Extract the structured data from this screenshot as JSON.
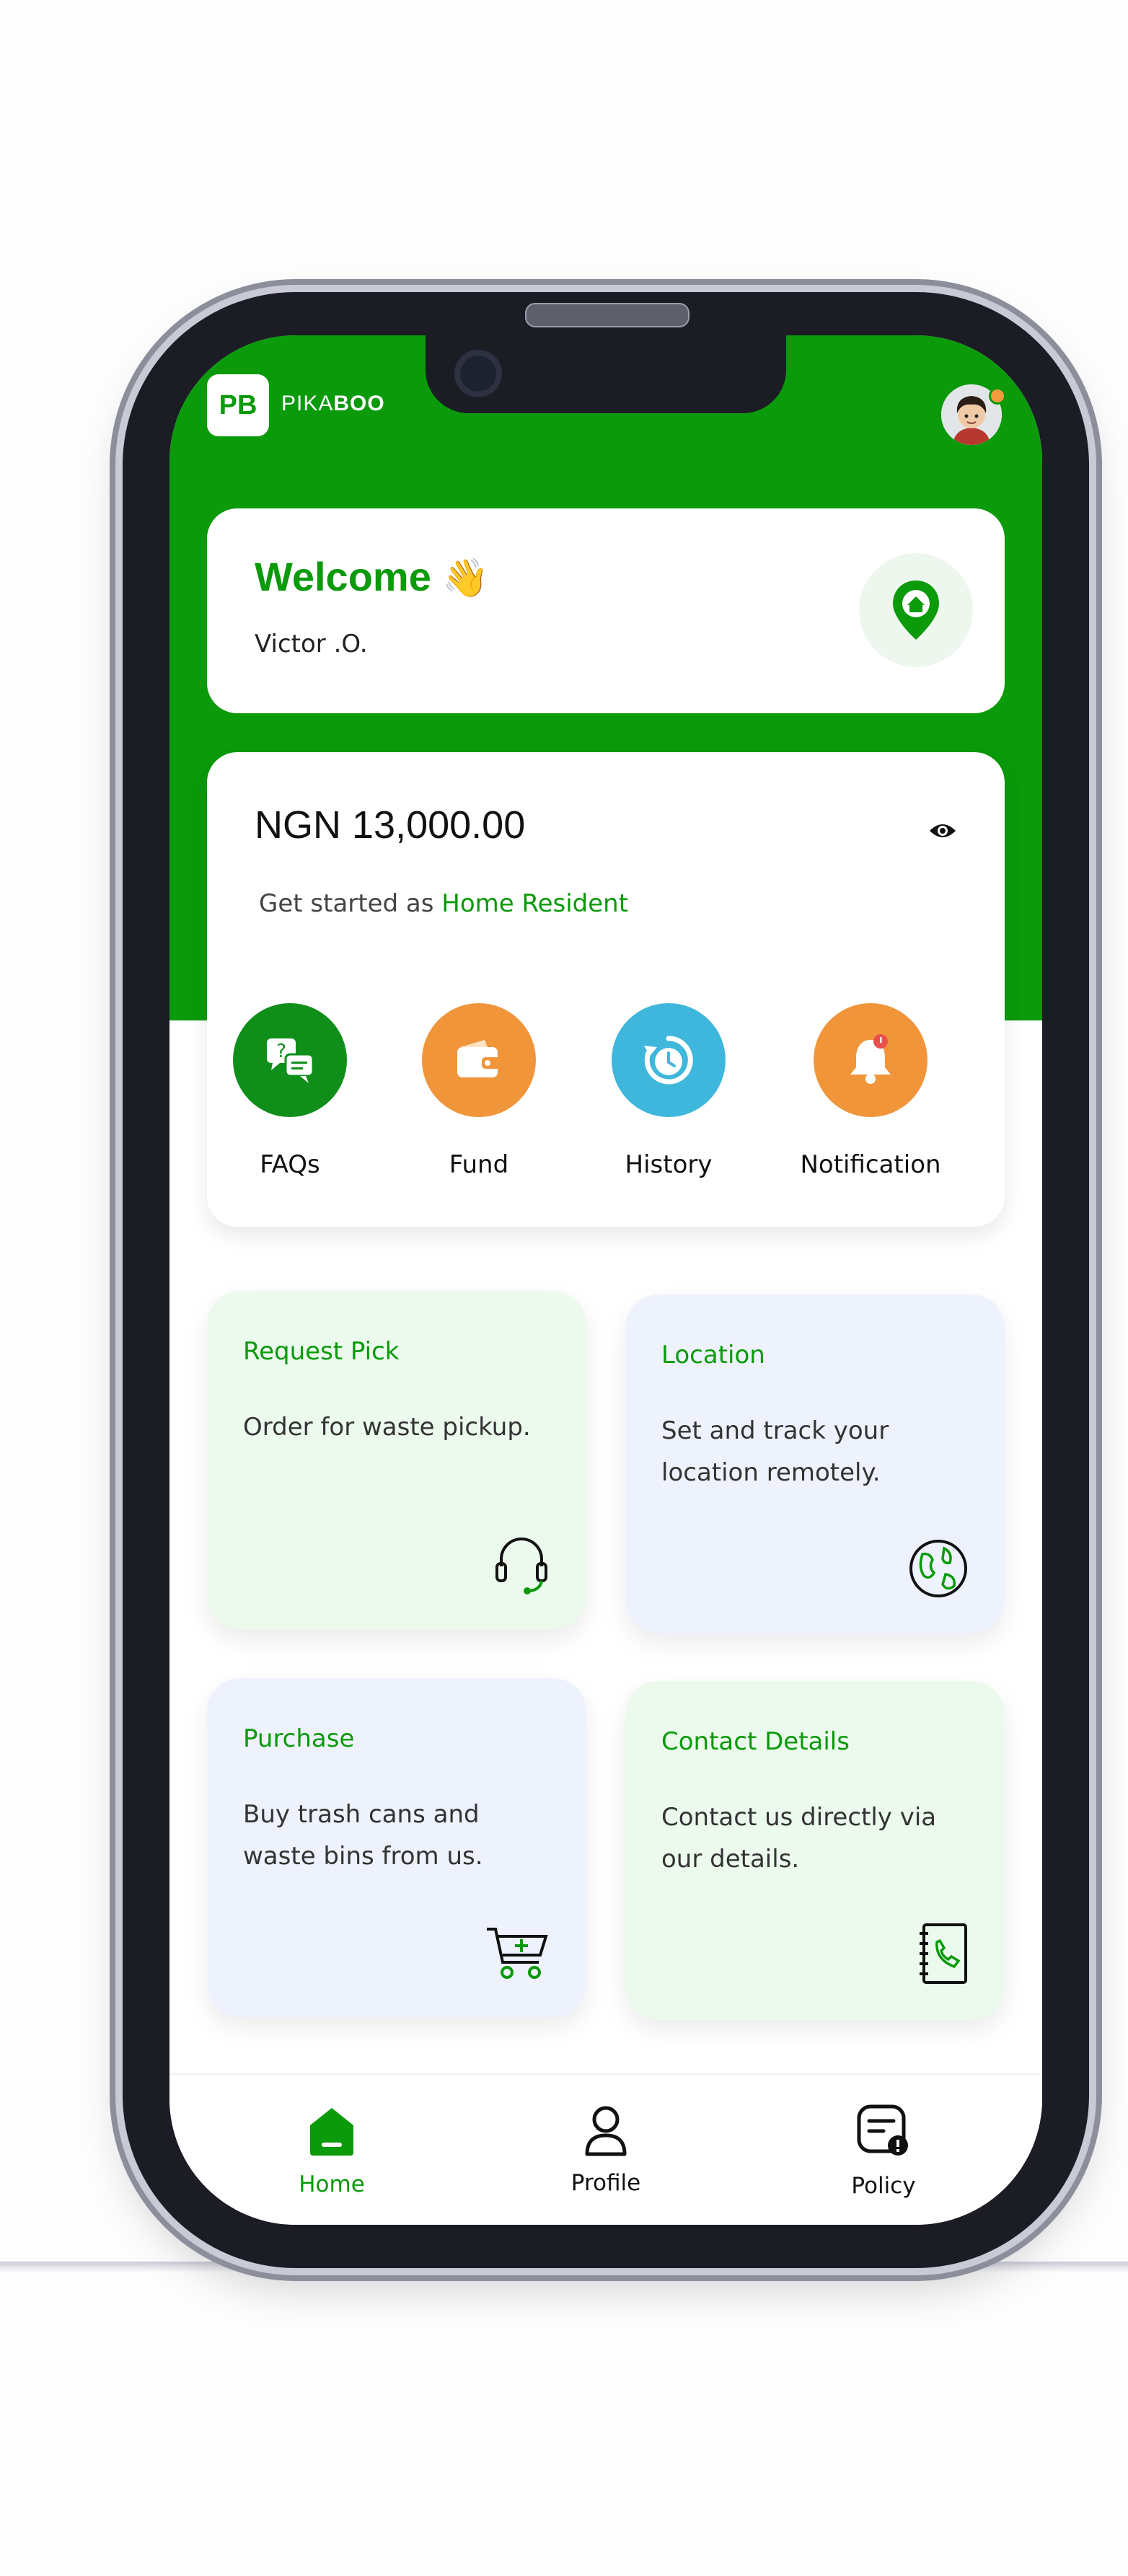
{
  "app": {
    "logo_text": "PB",
    "brand_light": "PIKA",
    "brand_bold": "BOO"
  },
  "welcome": {
    "title": "Welcome",
    "emoji": "👋",
    "user_name": "Victor .O."
  },
  "wallet": {
    "balance": "NGN 13,000.00",
    "get_started_prefix": "Get started as",
    "get_started_role": "Home Resident"
  },
  "quick_actions": [
    {
      "label": "FAQs",
      "icon": "faq-chat-icon",
      "color": "#0f8f1a"
    },
    {
      "label": "Fund",
      "icon": "wallet-icon",
      "color": "#f0953a"
    },
    {
      "label": "History",
      "icon": "history-clock-icon",
      "color": "#3fb7dc"
    },
    {
      "label": "Notification",
      "icon": "bell-icon",
      "color": "#f0953a"
    }
  ],
  "features": [
    {
      "title": "Request Pick",
      "desc": "Order for waste pickup.",
      "icon": "headset-icon"
    },
    {
      "title": "Location",
      "desc": "Set and track your location remotely.",
      "icon": "globe-icon"
    },
    {
      "title": "Purchase",
      "desc": "Buy trash cans and waste bins from us.",
      "icon": "cart-add-icon"
    },
    {
      "title": "Contact Details",
      "desc": "Contact us directly via our details.",
      "icon": "phonebook-icon"
    }
  ],
  "nav": [
    {
      "label": "Home",
      "icon": "home-icon",
      "active": true
    },
    {
      "label": "Profile",
      "icon": "user-icon",
      "active": false
    },
    {
      "label": "Policy",
      "icon": "policy-icon",
      "active": false
    }
  ],
  "colors": {
    "brand_green": "#0a9a0a",
    "card_green": "#ecfaee",
    "card_blue": "#eef2fd"
  }
}
